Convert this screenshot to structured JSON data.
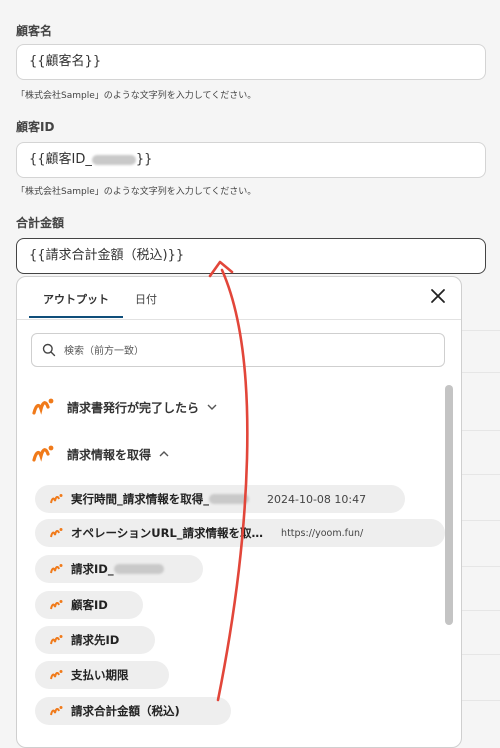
{
  "fields": {
    "customer_name": {
      "label": "顧客名",
      "value": "{{顧客名}}",
      "hint": "「株式会社Sample」のような文字列を入力してください。"
    },
    "customer_id": {
      "label": "顧客ID",
      "value_prefix": "{{顧客ID_",
      "value_suffix": "}}",
      "hint": "「株式会社Sample」のような文字列を入力してください。"
    },
    "total_amount": {
      "label": "合計金額",
      "value": "{{請求合計金額（税込)}}"
    }
  },
  "panel": {
    "tabs": [
      {
        "label": "アウトプット",
        "active": true
      },
      {
        "label": "日付",
        "active": false
      }
    ],
    "search_placeholder": "検索（前方一致）",
    "groups": [
      {
        "label": "請求書発行が完了したら",
        "expanded": false
      },
      {
        "label": "請求情報を取得",
        "expanded": true
      }
    ],
    "items": [
      {
        "label": "実行時間_請求情報を取得_",
        "value": "2024-10-08 10:47"
      },
      {
        "label": "オペレーションURL_請求情報を取…",
        "value": "https://yoom.fun/"
      },
      {
        "label": "請求ID_",
        "value": ""
      },
      {
        "label": "顧客ID",
        "value": ""
      },
      {
        "label": "請求先ID",
        "value": ""
      },
      {
        "label": "支払い期限",
        "value": ""
      },
      {
        "label": "請求合計金額（税込)",
        "value": ""
      }
    ]
  },
  "colors": {
    "accent_tab": "#0f4e7a",
    "arrow": "#e2463a",
    "icon_orange": "#f07a1a"
  },
  "icons": [
    "close-icon",
    "search-icon",
    "chevron-down-icon",
    "chevron-up-icon",
    "app-logo-icon"
  ]
}
